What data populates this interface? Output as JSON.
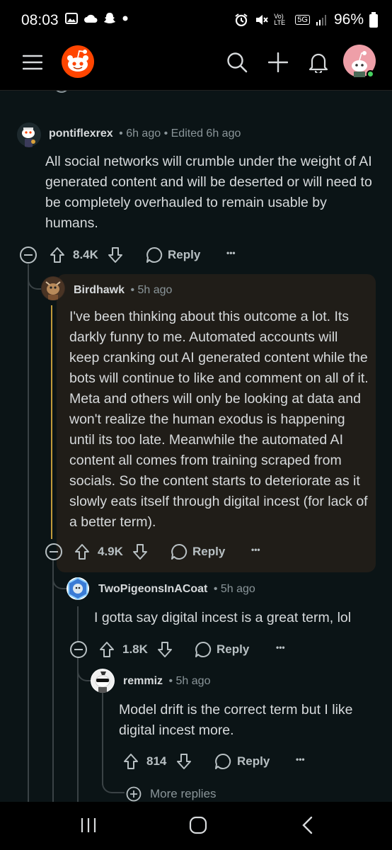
{
  "status_bar": {
    "time": "08:03",
    "battery": "96%",
    "network": "5G",
    "volte": "Vo) LTE"
  },
  "app_bar": {
    "icons": [
      "menu-icon",
      "reddit-logo",
      "search-icon",
      "plus-icon",
      "bell-icon",
      "user-avatar"
    ]
  },
  "comments": [
    {
      "author": "pontiflexrex",
      "meta": "• 6h ago • Edited 6h ago",
      "body": "All social networks will crumble under the weight of AI generated content and will be deserted or will need to be completely overhauled to remain usable by humans.",
      "votes": "8.4K",
      "reply": "Reply",
      "more": "•••"
    },
    {
      "author": "Birdhawk",
      "meta": "• 5h ago",
      "body": "I've been thinking about this outcome a lot. Its darkly funny to me. Automated accounts will keep cranking out AI generated content while the bots will continue to like and comment on all of it. Meta and others will only be looking at data and won't realize the human exodus is happening until its too late. Meanwhile the automated AI content all comes from training scraped from socials. So the content starts to deteriorate as it slowly eats itself through digital incest (for lack of a better term).",
      "votes": "4.9K",
      "reply": "Reply",
      "more": "•••"
    },
    {
      "author": "TwoPigeonsInACoat",
      "meta": "• 5h ago",
      "body": "I gotta say digital incest is a great term, lol",
      "votes": "1.8K",
      "reply": "Reply",
      "more": "•••"
    },
    {
      "author": "remmiz",
      "meta": "• 5h ago",
      "body": "Model drift is the correct term but I like digital incest more.",
      "votes": "814",
      "reply": "Reply",
      "more": "•••"
    }
  ],
  "more_replies": "More replies",
  "colors": {
    "background": "#0b1416",
    "highlight": "#201d18",
    "thread_line": "#3a4245",
    "gold_line": "#c09a3a",
    "reddit_orange": "#ff4500"
  }
}
